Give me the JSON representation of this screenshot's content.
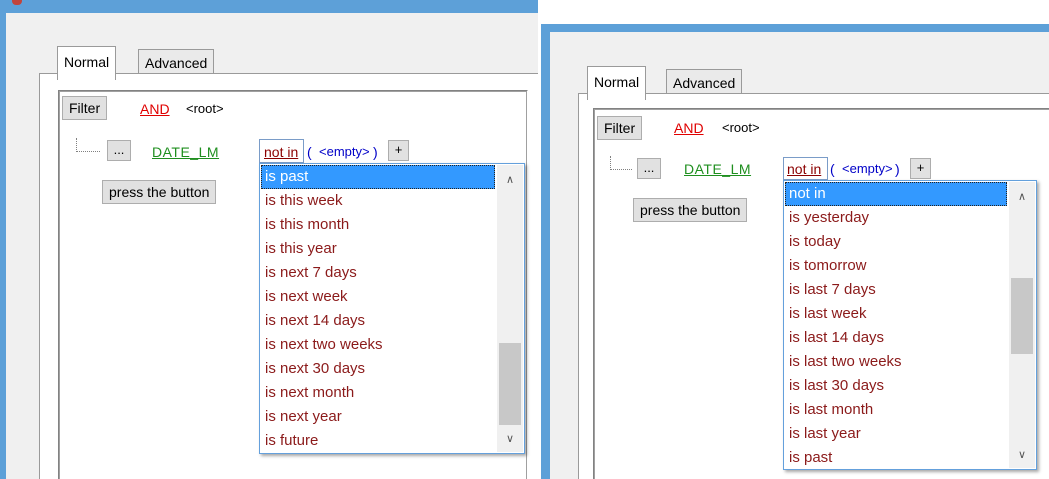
{
  "tabs": {
    "normal": "Normal",
    "advanced": "Advanced"
  },
  "filter_button": "Filter",
  "operator": "AND",
  "root_label": "<root>",
  "ellipsis_button": "...",
  "field_name": "DATE_LM",
  "condition": "not in",
  "value_open": "(",
  "value_empty": "<empty>",
  "value_close": ")",
  "add_button": "+",
  "press_button": "press the button",
  "scroll_icons": {
    "up": "chevron-up-icon",
    "down": "chevron-down-icon"
  },
  "colors": {
    "accent": "#5da0d8",
    "operator": "#e00000",
    "field": "#1f8f1f",
    "item": "#8b1a1a",
    "highlight": "#3399ff"
  },
  "left_dropdown": {
    "items": [
      "is past",
      "is this week",
      "is this month",
      "is this year",
      "is next 7 days",
      "is next week",
      "is next 14 days",
      "is next two weeks",
      "is next 30 days",
      "is next month",
      "is next year",
      "is future"
    ],
    "selected_index": 0,
    "scroll_position": 0.72
  },
  "right_dropdown": {
    "items": [
      "not in",
      "is yesterday",
      "is today",
      "is tomorrow",
      "is last 7 days",
      "is last week",
      "is last 14 days",
      "is last two weeks",
      "is last 30 days",
      "is last month",
      "is last year",
      "is past"
    ],
    "selected_index": 0,
    "scroll_position": 0.38
  }
}
